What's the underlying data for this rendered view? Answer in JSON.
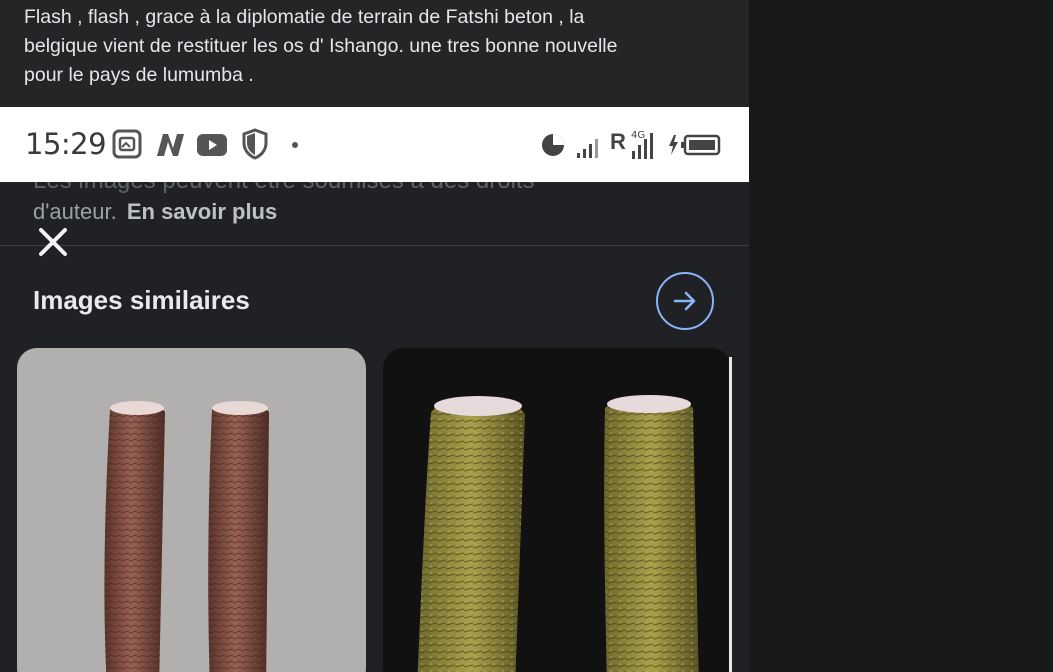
{
  "post": {
    "text_lines": [
      "Flash , flash , grace à la diplomatie de terrain de Fatshi beton , la",
      "belgique vient de restituer les os d' Ishango. une tres bonne nouvelle",
      "pour le pays de lumumba ."
    ]
  },
  "screenshot": {
    "status_bar": {
      "time": "15:29",
      "network_label": "R",
      "icons": [
        "photo-badge-icon",
        "n-app-icon",
        "youtube-icon",
        "shield-icon",
        "data-saver-icon",
        "signal-icon",
        "signal-4g-icon",
        "battery-charging-icon"
      ]
    },
    "copyright_cut_line": "Les images peuvent être soumises à des droits",
    "copyright_text": "d'auteur.",
    "learn_more": "En savoir plus",
    "close_icon": "close-icon",
    "section_title": "Images similaires",
    "next_icon": "arrow-right-icon",
    "images": [
      {
        "name": "ishango-bones-light",
        "description_icon": "bone-image"
      },
      {
        "name": "ishango-bones-dark",
        "description_icon": "bone-image"
      }
    ],
    "colors": {
      "accent": "#8ab4f8",
      "background": "#202124",
      "card_light": "#b1b0ae",
      "card_dark": "#111112"
    }
  }
}
